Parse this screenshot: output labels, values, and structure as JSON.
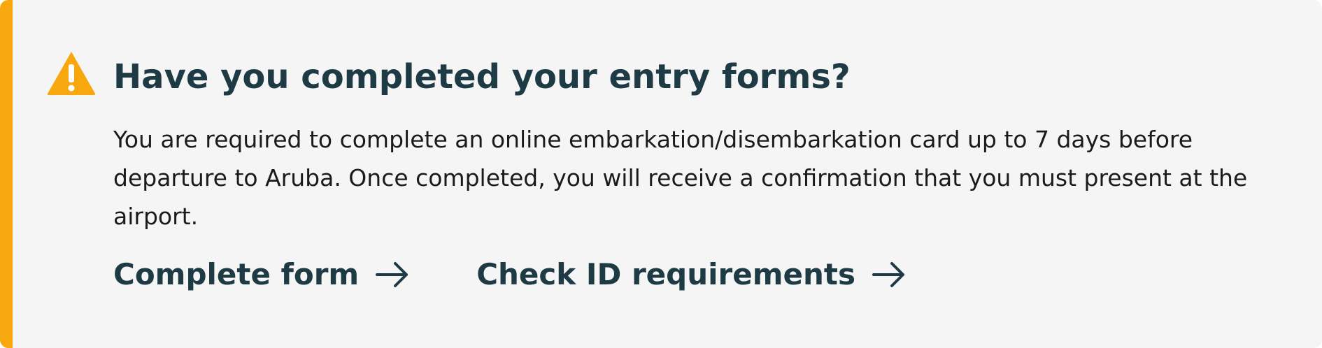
{
  "alert": {
    "title": "Have you completed your entry forms?",
    "body": "You are required to complete an online embarkation/disembarkation card up to 7 days before departure to Aruba. Once completed, you will receive a confirmation that you must present at the airport.",
    "icon": "warning-triangle-icon",
    "accent_color": "#f7a80f",
    "background_color": "#f5f5f5",
    "text_color": "#1e3a44"
  },
  "links": [
    {
      "label": "Complete form",
      "icon": "arrow-right-icon"
    },
    {
      "label": "Check ID requirements",
      "icon": "arrow-right-icon"
    }
  ]
}
